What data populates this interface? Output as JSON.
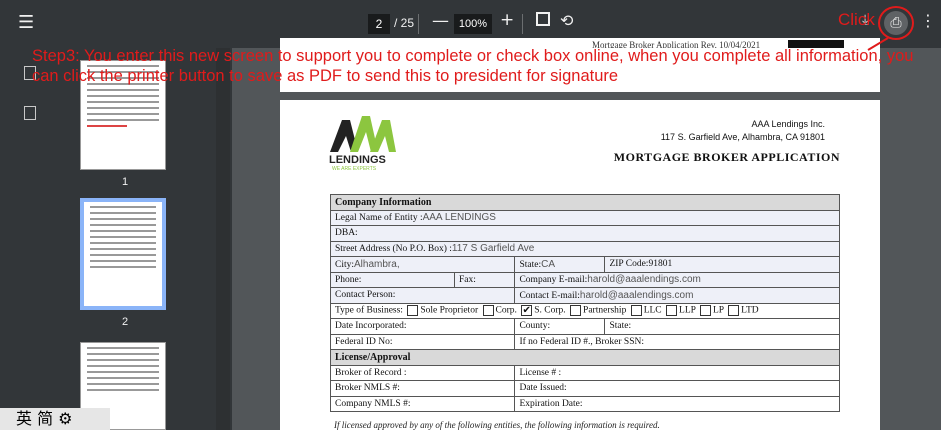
{
  "toolbar": {
    "menu_icon": "menu-icon",
    "page_current": "2",
    "page_total": "/ 25",
    "zoom_out": "—",
    "zoom_level": "100%",
    "zoom_in": "+",
    "fit_icon": "fit-page-icon",
    "rotate_icon": "rotate-icon",
    "download_icon": "download-icon",
    "print_icon": "print-icon",
    "more_icon": "more-vert-icon"
  },
  "sidebar": {
    "thumbnails": [
      {
        "number": "1",
        "selected": false
      },
      {
        "number": "2",
        "selected": true
      },
      {
        "number": "",
        "selected": false
      }
    ]
  },
  "ime": {
    "text": "英 简 ⚙"
  },
  "annotation": {
    "instruction": "Step3: You enter this new screen to support you to complete or check box online, when you complete all information, you can click the printer button  to save as PDF to send this to president for signature",
    "click_label": "Click",
    "color": "#e01b1b"
  },
  "document": {
    "prev_footer": "Mortgage Broker Application Rev. 10/04/2021",
    "logo_text": "LENDINGS",
    "logo_tagline": "WE ARE EXPERTS",
    "company_name": "AAA Lendings Inc.",
    "company_address": "117 S. Garfield Ave, Alhambra, CA 91801",
    "form_title": "MORTGAGE BROKER APPLICATION",
    "section_company": "Company Information",
    "legal_name_label": "Legal Name of Entity :",
    "legal_name_value": "AAA LENDINGS",
    "dba_label": "DBA:",
    "street_label": "Street Address (No P.O. Box) :",
    "street_value": "117 S Garfield Ave",
    "city_label": "City:",
    "city_value": "Alhambra,",
    "state_label": "State:",
    "state_value": "CA",
    "zip_label": "ZIP Code:",
    "zip_value": "91801",
    "phone_label": "Phone:",
    "fax_label": "Fax:",
    "company_email_label": "Company E-mail:",
    "company_email_value": "harold@aaalendings.com",
    "contact_person_label": "Contact Person:",
    "contact_email_label": "Contact E-mail:",
    "contact_email_value": "harold@aaalendings.com",
    "business_type_label": "Type of Business:",
    "business_types": [
      "Sole Proprietor",
      "Corp.",
      "S. Corp.",
      "Partnership",
      "LLC",
      "LLP",
      "LP",
      "LTD"
    ],
    "business_type_checked": "S. Corp.",
    "date_inc_label": "Date Incorporated:",
    "county_label": "County:",
    "state2_label": "State:",
    "federal_id_label": "Federal ID No:",
    "broker_ssn_label": "If no Federal ID #., Broker SSN:",
    "section_license": "License/Approval",
    "broker_record_label": "Broker of Record :",
    "license_no_label": "License # :",
    "broker_nmls_label": "Broker NMLS #:",
    "date_issued_label": "Date Issued:",
    "company_nmls_label": "Company NMLS #:",
    "expiration_label": "Expiration Date:",
    "note": "If licensed approved by any of the following entities, the following information is required."
  }
}
